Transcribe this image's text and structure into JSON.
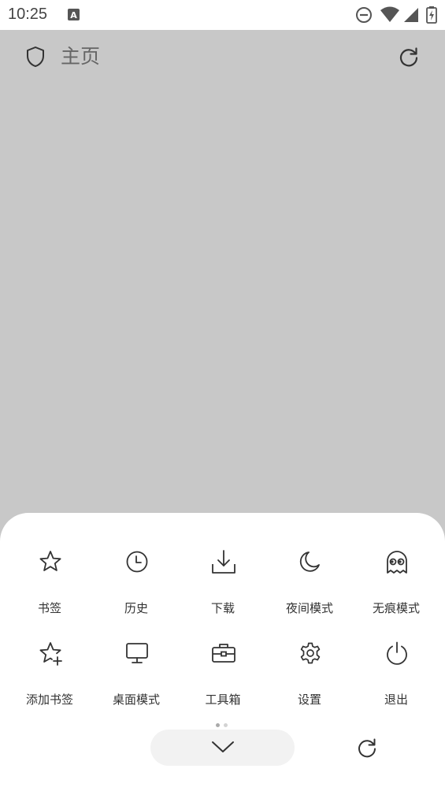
{
  "status_bar": {
    "time": "10:25"
  },
  "address_bar": {
    "title": "主页"
  },
  "menu": {
    "items": [
      {
        "label": "书签",
        "icon": "star-icon"
      },
      {
        "label": "历史",
        "icon": "clock-icon"
      },
      {
        "label": "下载",
        "icon": "download-icon"
      },
      {
        "label": "夜间模式",
        "icon": "moon-icon"
      },
      {
        "label": "无痕模式",
        "icon": "ghost-icon"
      },
      {
        "label": "添加书签",
        "icon": "star-plus-icon"
      },
      {
        "label": "桌面模式",
        "icon": "monitor-icon"
      },
      {
        "label": "工具箱",
        "icon": "toolbox-icon"
      },
      {
        "label": "设置",
        "icon": "gear-icon"
      },
      {
        "label": "退出",
        "icon": "power-icon"
      }
    ]
  },
  "colors": {
    "page_background": "#c8c8c8",
    "sheet_background": "#ffffff",
    "icon_stroke": "#333333",
    "pill_background": "#f2f2f2",
    "dot_active": "#aaaaaa",
    "dot_inactive": "#d3d3d3"
  }
}
